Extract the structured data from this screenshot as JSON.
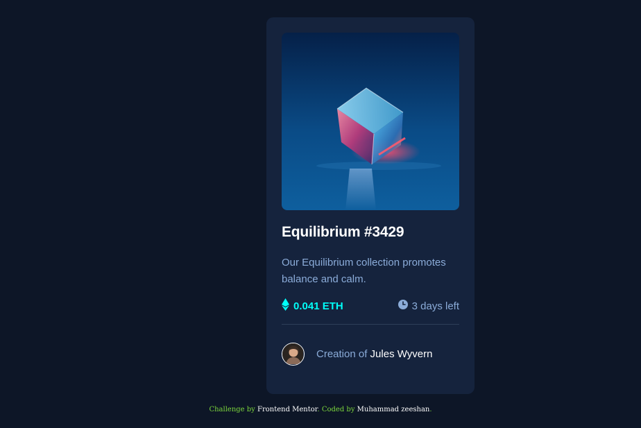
{
  "card": {
    "image_alt": "equilibrium-image",
    "title": "Equilibrium #3429",
    "description": "Our Equilibrium collection promotes balance and calm.",
    "price": "0.041 ETH",
    "time_left": "3 days left",
    "creator_prefix": "Creation of",
    "creator_name": "Jules Wyvern"
  },
  "attribution": {
    "challenge_prefix": "Challenge by",
    "challenge_link": "Frontend Mentor",
    "separator": ".",
    "coded_prefix": "Coded by",
    "coded_link": "Muhammad zeeshan",
    "end": "."
  },
  "colors": {
    "page_bg": "#0d1627",
    "card_bg": "#15233d",
    "cyan": "#00fff8",
    "soft_blue": "#8bacd9",
    "white": "#ffffff",
    "attribution_green": "#7cd63c"
  },
  "icons": {
    "eth": "ethereum-icon",
    "clock": "clock-icon"
  }
}
